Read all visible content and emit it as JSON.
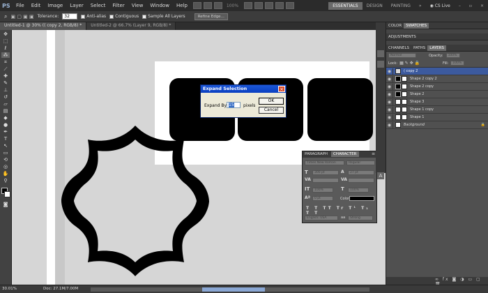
{
  "app": {
    "logo": "PS"
  },
  "menu": [
    "File",
    "Edit",
    "Image",
    "Layer",
    "Select",
    "Filter",
    "View",
    "Window",
    "Help"
  ],
  "zoom_display": "100%",
  "workspaces": {
    "essentials": "ESSENTIALS",
    "design": "DESIGN",
    "painting": "PAINTING",
    "cs_live": "CS Live"
  },
  "options": {
    "tolerance_label": "Tolerance:",
    "tolerance_value": "32",
    "anti_alias": "Anti-alias",
    "contiguous": "Contiguous",
    "sample_all": "Sample All Layers",
    "refine": "Refine Edge..."
  },
  "doc_tabs": [
    "Untitled-1 @ 30% (( copy 2, RGB/8) *",
    "Untitled-2 @ 66.7% (Layer 9, RGB/8) *"
  ],
  "status": {
    "zoom": "30.01%",
    "doc": "Doc: 27.1M/7.00M"
  },
  "dialog": {
    "title": "Expand Selection",
    "label": "Expand By:",
    "value": "15",
    "unit": "pixels",
    "ok": "OK",
    "cancel": "Cancel"
  },
  "char_panel": {
    "tab1": "PARAGRAPH",
    "tab2": "CHARACTER",
    "font": "Times New Roman",
    "style": "Regular",
    "size": "300 pt",
    "leading": "27 pt",
    "tracking": "100%",
    "kerning": "100%",
    "baseline": "0 pt",
    "color_label": "Color:",
    "lang": "English: USA",
    "aa": "Strong"
  },
  "right_panel": {
    "tabs_top": [
      "COLOR",
      "SWATCHES"
    ],
    "adjustments": "ADJUSTMENTS",
    "tabs_layers": [
      "CHANNELS",
      "PATHS",
      "LAYERS"
    ],
    "blend": "Normal",
    "opacity_label": "Opacity:",
    "opacity": "100%",
    "lock_label": "Lock:",
    "fill_label": "Fill:",
    "fill": "100%",
    "layers": [
      "( copy 2",
      "Shape 2 copy 2",
      "Shape 2 copy",
      "Shape 2",
      "Shape 3",
      "Shape 1 copy",
      "Shape 1",
      "Background"
    ]
  }
}
